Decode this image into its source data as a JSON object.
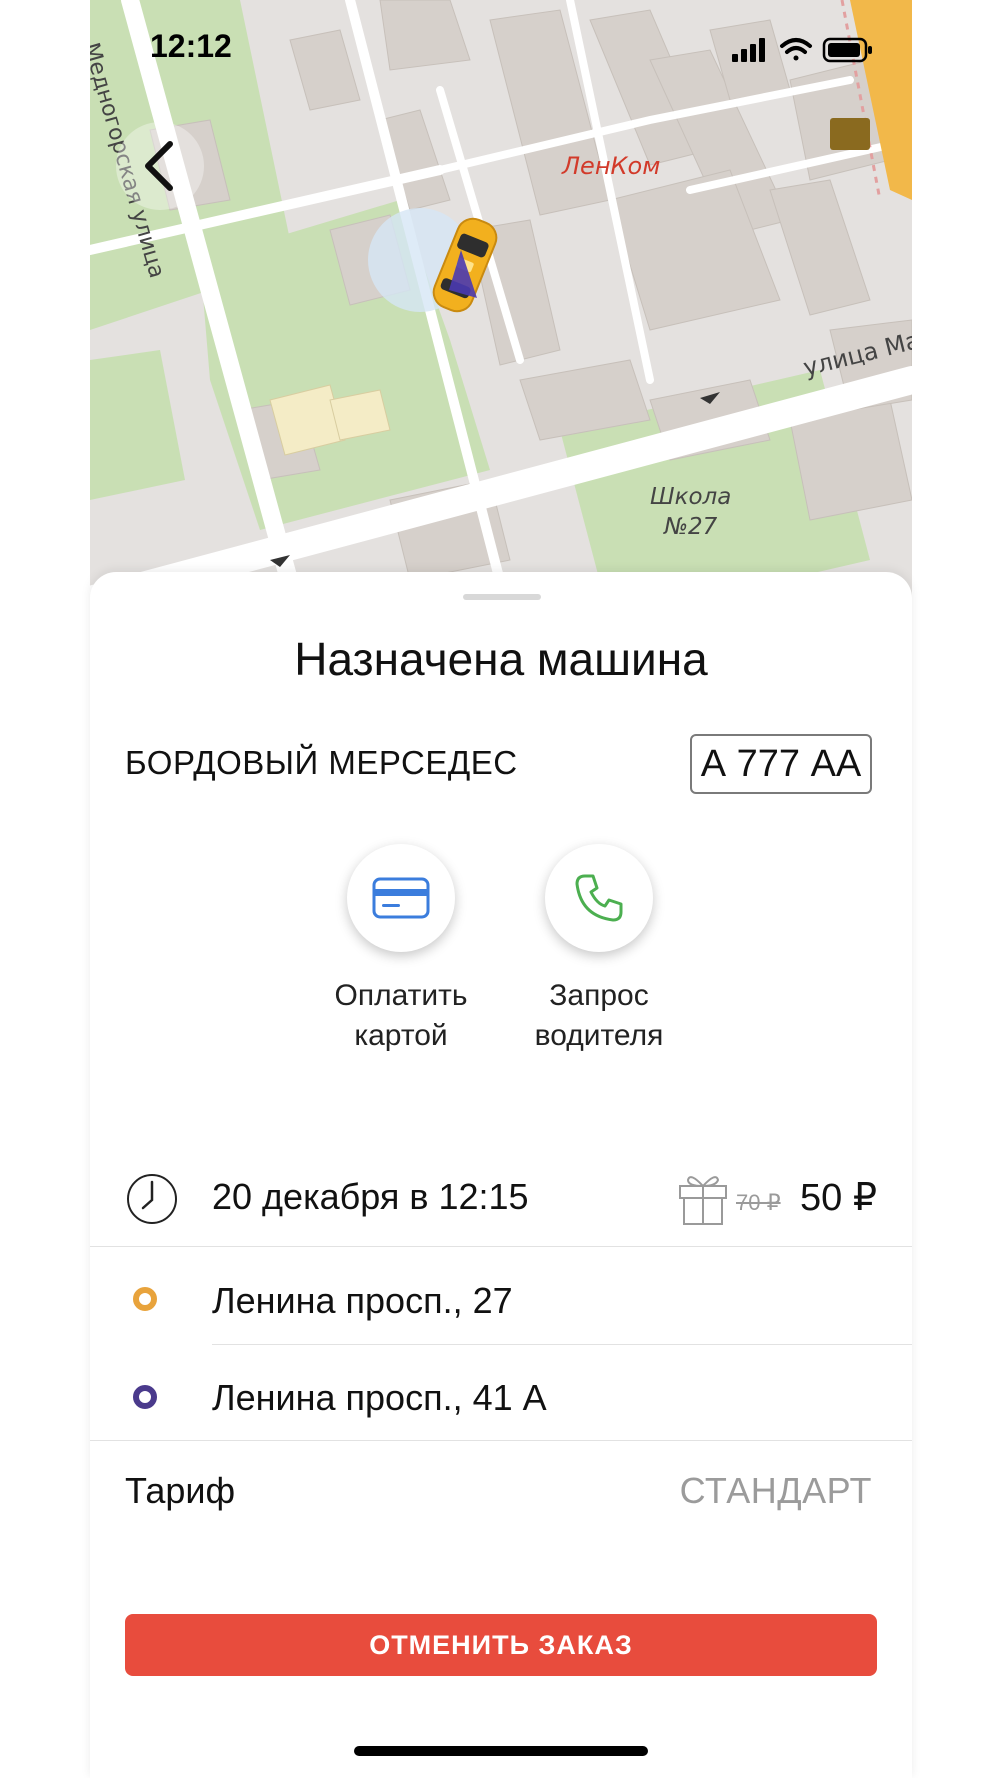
{
  "status_bar": {
    "time": "12:12"
  },
  "map": {
    "street_left": "Медногорская улица",
    "street_right": "улица Ма",
    "poi_lenkom": "ЛенКом",
    "school_line1": "Школа",
    "school_line2": "№27",
    "back_icon": "chevron-left-icon",
    "car_icon": "taxi-car-icon"
  },
  "sheet": {
    "title": "Назначена машина",
    "car_description": "БОРДОВЫЙ МЕРСЕДЕС",
    "plate_number": "А 777 АА",
    "actions": [
      {
        "label_line1": "Оплатить",
        "label_line2": "картой",
        "icon": "credit-card-icon"
      },
      {
        "label_line1": "Запрос",
        "label_line2": "водителя",
        "icon": "phone-icon"
      }
    ],
    "time_row": {
      "datetime": "20 декабря в 12:15",
      "price_old": "70 ₽",
      "price_new": "50 ₽",
      "icons": [
        "clock-icon",
        "gift-icon"
      ]
    },
    "route": {
      "from": "Ленина просп., 27",
      "to": "Ленина просп., 41 А"
    },
    "tariff": {
      "label": "Тариф",
      "value": "СТАНДАРТ"
    },
    "cancel_label": "ОТМЕНИТЬ ЗАКАЗ"
  },
  "colors": {
    "accent_red": "#e84c3d",
    "origin_orange": "#e8a33c",
    "destination_purple": "#4a3a8c",
    "park_green": "#c9dfb4",
    "card_blue": "#3b7ddd",
    "phone_green": "#4caf50"
  }
}
